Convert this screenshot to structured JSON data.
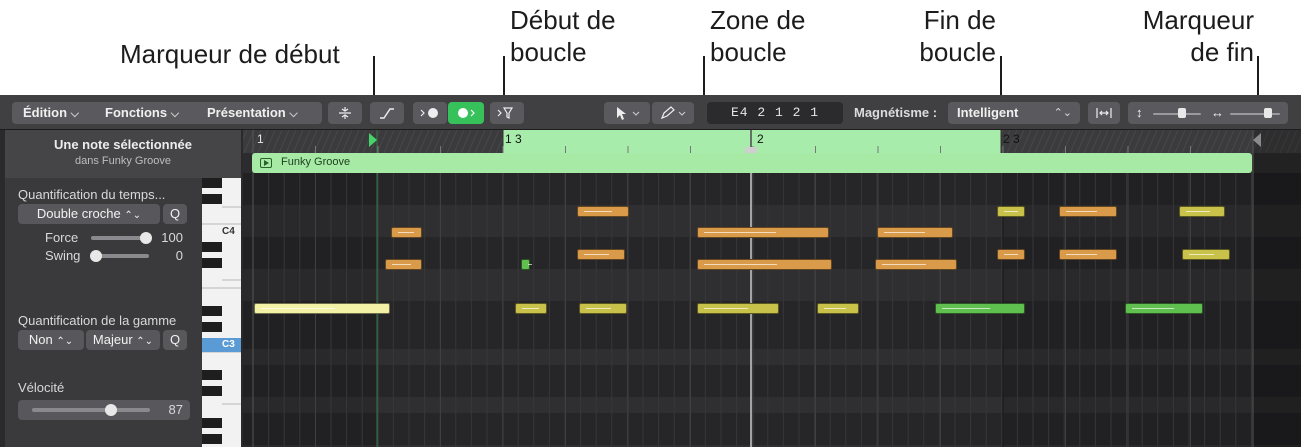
{
  "callouts": {
    "start_marker": "Marqueur de début",
    "loop_start": [
      "Début de",
      "boucle"
    ],
    "loop_zone": [
      "Zone de",
      "boucle"
    ],
    "loop_end": [
      "Fin de",
      "boucle"
    ],
    "end_marker": [
      "Marqueur",
      "de fin"
    ]
  },
  "toolbar": {
    "menu_edit": "Édition",
    "menu_functions": "Fonctions",
    "menu_view": "Présentation",
    "position": "E4  2 1 2 1",
    "snap_label": "Magnétisme :",
    "snap_value": "Intelligent"
  },
  "inspector": {
    "title": "Une note sélectionnée",
    "subtitle": "dans Funky Groove",
    "time_quantize": {
      "label": "Quantification du temps...",
      "value": "Double croche",
      "q_button": "Q",
      "strength_label": "Force",
      "strength_value": "100",
      "swing_label": "Swing",
      "swing_value": "0"
    },
    "scale_quantize": {
      "label": "Quantification de la gamme",
      "root": "Non",
      "mode": "Majeur",
      "q_button": "Q"
    },
    "velocity": {
      "label": "Vélocité",
      "value": "87"
    }
  },
  "keyboard": {
    "c4": "C4",
    "c3": "C3"
  },
  "ruler": {
    "bar1": "1",
    "loop_start": "1 3",
    "bar2": "2",
    "loop_end": "2 3"
  },
  "region": {
    "name": "Funky Groove"
  },
  "colors": {
    "loop_green": "#a8ecab",
    "region_green": "#a6eaa6",
    "note_orange": "#d99a4a",
    "note_yellow": "#c8c24a",
    "note_green": "#5fbf4f",
    "note_selected": "#f3f1a6"
  }
}
